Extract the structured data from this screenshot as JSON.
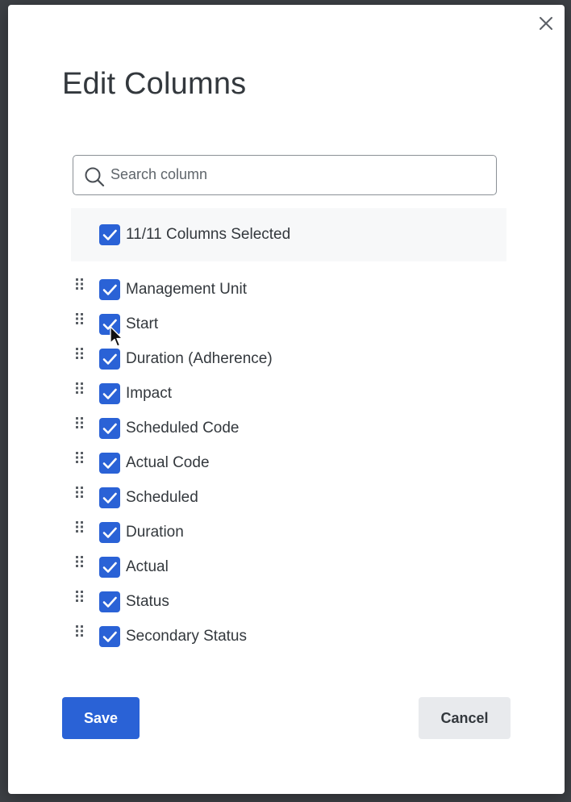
{
  "dialog": {
    "title": "Edit Columns",
    "close_icon": "close-icon"
  },
  "search": {
    "placeholder": "Search column",
    "value": "",
    "icon": "search-icon"
  },
  "select_all": {
    "label": "11/11 Columns Selected",
    "checked": true
  },
  "columns": [
    {
      "label": "Management Unit",
      "checked": true
    },
    {
      "label": "Start",
      "checked": true
    },
    {
      "label": "Duration (Adherence)",
      "checked": true
    },
    {
      "label": "Impact",
      "checked": true
    },
    {
      "label": "Scheduled Code",
      "checked": true
    },
    {
      "label": "Actual Code",
      "checked": true
    },
    {
      "label": "Scheduled",
      "checked": true
    },
    {
      "label": "Duration",
      "checked": true
    },
    {
      "label": "Actual",
      "checked": true
    },
    {
      "label": "Status",
      "checked": true
    },
    {
      "label": "Secondary Status",
      "checked": true
    }
  ],
  "buttons": {
    "save": "Save",
    "cancel": "Cancel"
  },
  "colors": {
    "accent": "#2a62d6",
    "text": "#33383d",
    "cancel_bg": "#e8eaed",
    "backdrop": "#3d4045"
  }
}
